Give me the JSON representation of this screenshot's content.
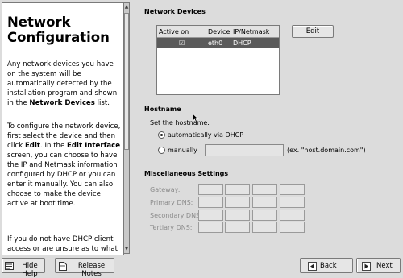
{
  "help": {
    "title": "Network Configuration",
    "p1": "Any network devices you have on the system will be automatically detected by the installation program and shown in the Network Devices list.",
    "p2": "To configure the network device, first select the device and then click Edit. In the Edit Interface screen, you can choose to have the IP and Netmask information configured by DHCP or you can enter it manually. You can also choose to make the device active at boot time.",
    "p3": "If you do not have DHCP client access or are unsure as to what this information is, please contact your network administrator."
  },
  "devices": {
    "section_label": "Network Devices",
    "columns": [
      "Active on Boot",
      "Device",
      "IP/Netmask"
    ],
    "rows": [
      {
        "active": "☑",
        "device": "eth0",
        "ip": "DHCP"
      }
    ],
    "edit_label": "Edit"
  },
  "hostname": {
    "section_label": "Hostname",
    "set_label": "Set the hostname:",
    "auto_label": "automatically via DHCP",
    "manual_label": "manually",
    "manual_value": "",
    "example": "(ex. \"host.domain.com\")",
    "selected": "automatically via DHCP"
  },
  "misc": {
    "section_label": "Miscellaneous Settings",
    "gateway_label": "Gateway:",
    "primary_dns_label": "Primary DNS:",
    "secondary_dns_label": "Secondary DNS:",
    "tertiary_dns_label": "Tertiary DNS:"
  },
  "footer": {
    "hide_help": "Hide Help",
    "release_notes": "Release Notes",
    "back": "Back",
    "next": "Next"
  }
}
